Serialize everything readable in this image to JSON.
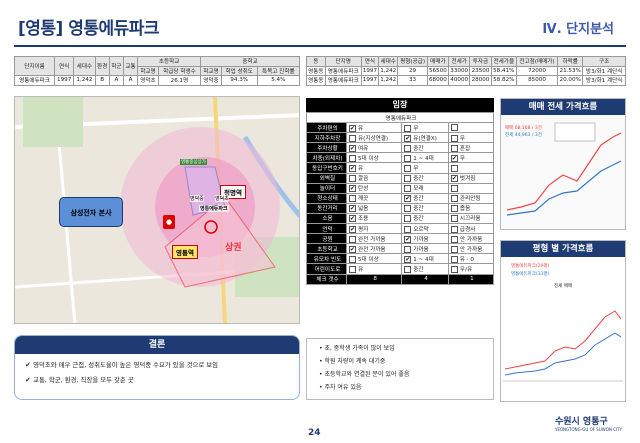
{
  "header": {
    "title": "[영통] 영통에듀파크",
    "chapter": "Ⅳ. 단지분석"
  },
  "table_left": {
    "headers": [
      "단지이름",
      "연식",
      "세대수",
      "환경",
      "학군",
      "교통",
      "초등학교",
      "",
      "중학교",
      ""
    ],
    "sub_headers": [
      "학교명",
      "학급당 학생수",
      "학교명",
      "학업 성취도",
      "특목고 진학률"
    ],
    "row": [
      "영통에듀파크",
      "1997",
      "1,242",
      "B",
      "A",
      "A",
      "영덕초",
      "26.1명",
      "영덕중",
      "94.3%",
      "5.4%"
    ]
  },
  "table_right": {
    "headers": [
      "동",
      "단지명",
      "연식",
      "세대수",
      "평형(공급)",
      "매매가",
      "전세가",
      "투자금",
      "전세가율",
      "전고점(매매가)",
      "하락률",
      "구조"
    ],
    "rows": [
      [
        "영통동",
        "영통에듀파크",
        "1997",
        "1,242",
        "29",
        "56500",
        "33000",
        "23500",
        "58.41%",
        "72000",
        "21.53%",
        "방3/화1 계단식"
      ],
      [
        "영통동",
        "영통에듀파크",
        "1997",
        "1,242",
        "33",
        "68000",
        "40000",
        "28000",
        "58.82%",
        "85000",
        "20.00%",
        "방3/화1 계단식"
      ]
    ]
  },
  "map": {
    "labels": {
      "samsung": "삼성전자 본사",
      "complex": "영통에듀파크",
      "station1": "청명역",
      "station2": "영통역",
      "commercial": "상권",
      "school": "영덕중",
      "elem": "영덕초",
      "market": "영통중심상가"
    }
  },
  "conclusion": {
    "title": "결론",
    "items": [
      "영덕초와 매우 근접, 성취도율이 높은 영덕중 수요가 있을 것으로 보임",
      "교통, 학군, 환경, 직장을 모두 갖춘 곳"
    ]
  },
  "site": {
    "title": "임장",
    "complex": "영통에듀파크",
    "rows": [
      {
        "k": "주차편의",
        "opts": [
          [
            "유",
            true
          ],
          [
            "무",
            false
          ],
          [
            "",
            false
          ]
        ]
      },
      {
        "k": "지하주차장",
        "opts": [
          [
            "유(지상연결)",
            false
          ],
          [
            "유(연결X)",
            true
          ],
          [
            "무",
            false
          ]
        ]
      },
      {
        "k": "주차상황",
        "opts": [
          [
            "여유",
            true
          ],
          [
            "중간",
            false
          ],
          [
            "혼잡",
            false
          ]
        ]
      },
      {
        "k": "차종(외제차)",
        "opts": [
          [
            "5대 이상",
            false
          ],
          [
            "1 ~ 4대",
            false
          ],
          [
            "무",
            true
          ]
        ]
      },
      {
        "k": "동입구번호키",
        "opts": [
          [
            "유",
            true
          ],
          [
            "무",
            false
          ],
          [
            "",
            false
          ]
        ]
      },
      {
        "k": "외벽칠",
        "opts": [
          [
            "깔끔",
            false
          ],
          [
            "중간",
            false
          ],
          [
            "벗겨짐",
            true
          ]
        ]
      },
      {
        "k": "놀이터",
        "opts": [
          [
            "탄성",
            true
          ],
          [
            "모래",
            false
          ],
          [
            "",
            false
          ]
        ]
      },
      {
        "k": "청소상태",
        "opts": [
          [
            "깨끗",
            false
          ],
          [
            "중간",
            true
          ],
          [
            "관리안됨",
            false
          ]
        ]
      },
      {
        "k": "동간거리",
        "opts": [
          [
            "넓음",
            true
          ],
          [
            "중간",
            false
          ],
          [
            "좁음",
            false
          ]
        ]
      },
      {
        "k": "소음",
        "opts": [
          [
            "조용",
            true
          ],
          [
            "중간",
            false
          ],
          [
            "시끄러움",
            false
          ]
        ]
      },
      {
        "k": "언덕",
        "opts": [
          [
            "평지",
            true
          ],
          [
            "오르막",
            false
          ],
          [
            "급경사",
            false
          ]
        ]
      },
      {
        "k": "공원",
        "opts": [
          [
            "완전 가까움",
            false
          ],
          [
            "가까움",
            true
          ],
          [
            "안 가까움",
            false
          ]
        ]
      },
      {
        "k": "초등학교",
        "opts": [
          [
            "완전 가까움",
            true
          ],
          [
            "가까움",
            false
          ],
          [
            "안 가까움",
            false
          ]
        ]
      },
      {
        "k": "유모차 빈도",
        "opts": [
          [
            "5대 이상",
            false
          ],
          [
            "1 ~ 4대",
            true
          ],
          [
            "유 · 0",
            false
          ]
        ]
      },
      {
        "k": "어린이도로",
        "opts": [
          [
            "유",
            false
          ],
          [
            "중간",
            false
          ],
          [
            "무/유",
            false
          ]
        ]
      }
    ],
    "count_label": "체크 갯수",
    "counts": [
      "8",
      "4",
      "1"
    ]
  },
  "notes": {
    "items": [
      "초, 중학생 가족이 많이 보임",
      "학원 차량이 계속 대기중",
      "초등학교와 연결된 문이 있어 좋음",
      "주차 여유 있음"
    ]
  },
  "panel1": {
    "title": "매매 전세 가격흐름",
    "legend": "매매 68,168 / 3건",
    "legend2": "전세 44,963 / 3건"
  },
  "panel2": {
    "title": "평형 별 가격흐름",
    "legend1": "영통에듀파크(29평)",
    "legend2": "영통에듀파크(33평)",
    "chart_title": "전세 매매"
  },
  "footer": {
    "page": "24",
    "logo": "수원시 영통구",
    "logo_sub": "YEONGTONG-GU OF SUWON CITY"
  },
  "colors": {
    "accent": "#1f3b73",
    "check_red": "#d33"
  }
}
